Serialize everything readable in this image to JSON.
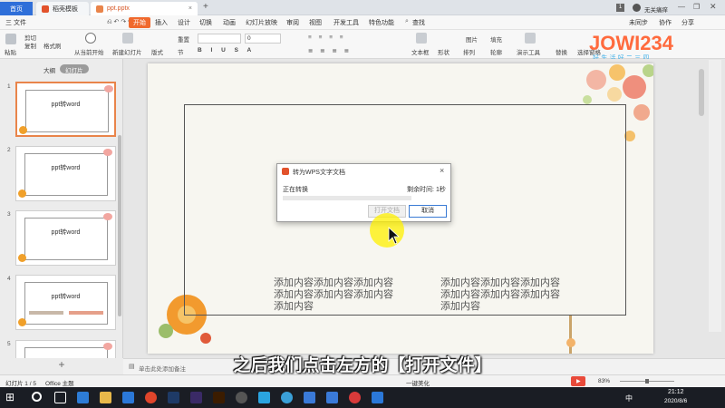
{
  "titlebar": {
    "home_tab": "首页",
    "template_tab": "稻壳模板",
    "doc_tab": "ppt.pptx",
    "new_tab": "+",
    "badge": "1",
    "user": "无关痛痒"
  },
  "menubar": {
    "file": "三 文件",
    "items": [
      "开始",
      "插入",
      "设计",
      "切换",
      "动画",
      "幻灯片放映",
      "审阅",
      "视图",
      "开发工具",
      "特色功能"
    ],
    "search": "查找",
    "sync": "未同步",
    "collab": "协作",
    "share": "分享"
  },
  "toolbar": {
    "paste": "粘贴",
    "cut": "剪切",
    "copy": "复制",
    "format_painter": "格式刷",
    "play": "从当前开始",
    "new_slide": "新建幻灯片",
    "layout": "版式",
    "section": "节",
    "reset": "重置",
    "font_size": "0",
    "textbox": "文本框",
    "shape": "形状",
    "arrange": "排列",
    "outline": "轮廓",
    "image": "图片",
    "fill": "填充",
    "presentation_tools": "演示工具",
    "replace": "替换",
    "select_pane": "选择窗格"
  },
  "logo": {
    "text": "JOWI234",
    "tagline": "好 生 活 好 二 三 四",
    "colors": [
      "#ff6a3d",
      "#ffb21a",
      "#3fb0e8",
      "#8cc63f"
    ]
  },
  "panel": {
    "tab_outline": "大纲",
    "tab_slides": "幻灯片",
    "slides": [
      {
        "num": "1",
        "title": "ppt转word"
      },
      {
        "num": "2",
        "title": "ppt转word"
      },
      {
        "num": "3",
        "title": "ppt转word"
      },
      {
        "num": "4",
        "title": "ppt转word"
      },
      {
        "num": "5",
        "title": ""
      }
    ],
    "add": "+"
  },
  "slide_content": {
    "text_left": [
      "添加内容添加内容添加内容",
      "添加内容添加内容添加内容",
      "添加内容"
    ],
    "text_right": [
      "添加内容添加内容添加内容",
      "添加内容添加内容添加内容",
      "添加内容"
    ]
  },
  "dialog": {
    "title": "转为WPS文字文档",
    "status": "正在转换",
    "remaining_label": "剩余时间:",
    "remaining_value": "1秒",
    "open_btn": "打开文档",
    "cancel_btn": "取消",
    "progress": 0.0
  },
  "notes": {
    "placeholder": "单击此处添加备注"
  },
  "subtitle": "之后我们点击左方的【打开文件】",
  "status": {
    "slide": "幻灯片 1 / 5",
    "theme": "Office 主题",
    "beautify": "一键美化",
    "zoom": "83%"
  },
  "taskbar": {
    "time": "21:12",
    "date": "2020/8/6",
    "ime": "中"
  }
}
